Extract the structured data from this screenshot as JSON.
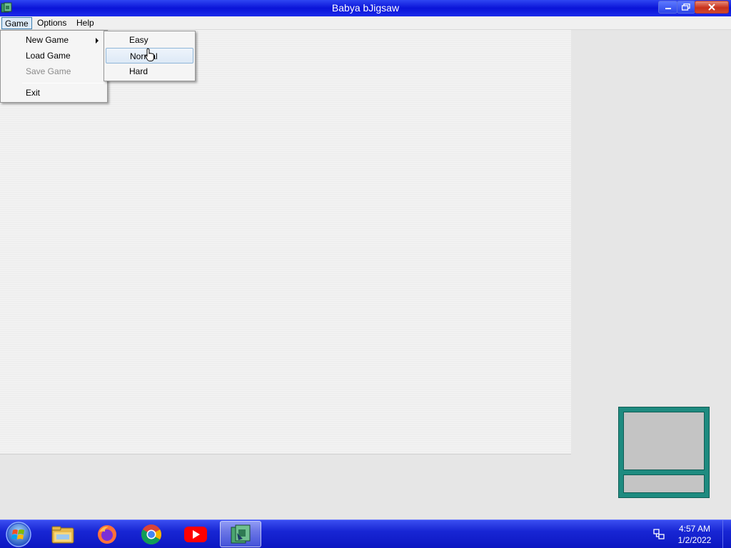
{
  "window": {
    "title": "Babya bJigsaw"
  },
  "menubar": {
    "game": "Game",
    "options": "Options",
    "help": "Help"
  },
  "game_menu": {
    "new_game": "New Game",
    "load_game": "Load Game",
    "save_game": "Save Game",
    "exit": "Exit"
  },
  "new_game_submenu": {
    "easy": "Easy",
    "normal": "Normal",
    "hard": "Hard"
  },
  "taskbar": {
    "apps": [
      "explorer-icon",
      "firefox-icon",
      "chrome-icon",
      "youtube-icon",
      "jigsaw-icon"
    ],
    "active_app": "jigsaw-icon"
  },
  "tray": {
    "time": "4:57 AM",
    "date": "1/2/2022"
  },
  "colors": {
    "titlebar": "#0a14d8",
    "taskbar": "#1826d4",
    "preview_frame": "#1e8b80",
    "menu_hover": "#dceaf7"
  }
}
